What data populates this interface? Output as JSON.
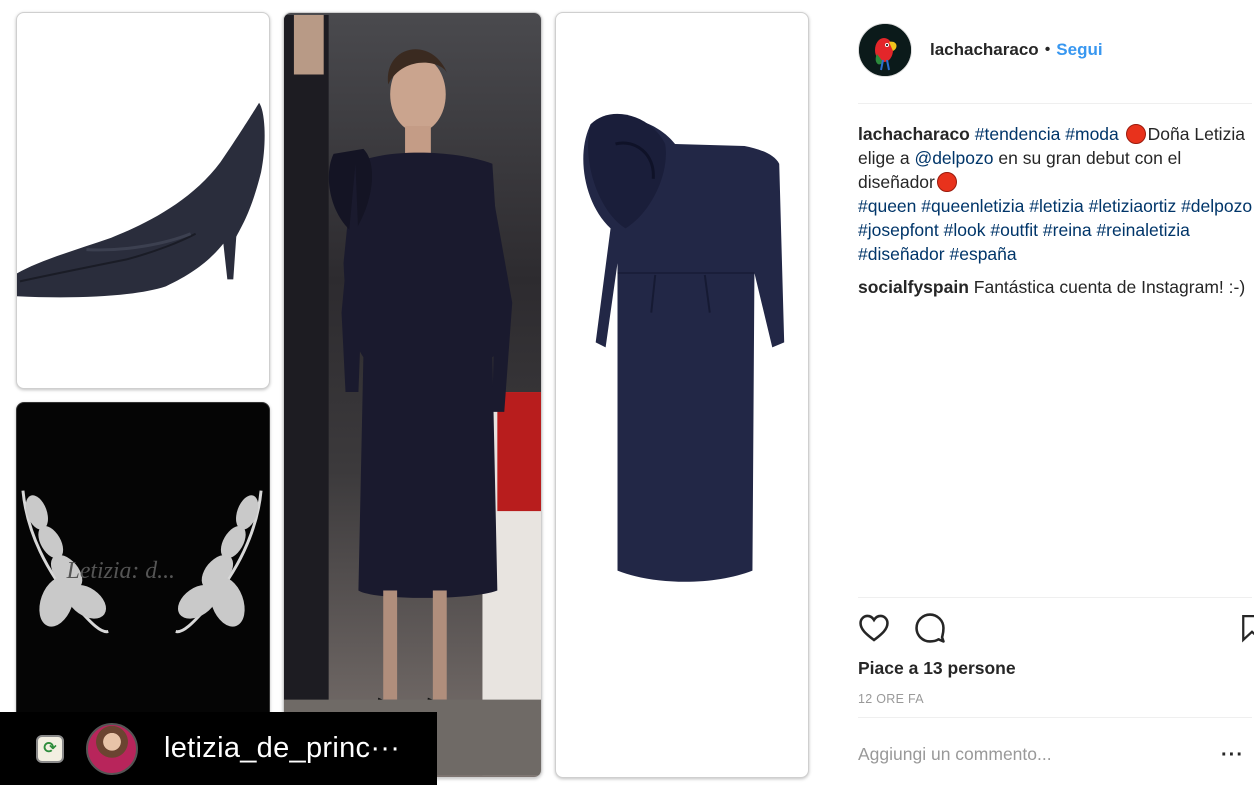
{
  "post": {
    "username": "lachacharaco",
    "follow_label": "Segui",
    "separator": "•"
  },
  "collage": {
    "repost_username": "letizia_de_princ···",
    "watermark": "Letizia: d..."
  },
  "caption": {
    "username": "lachacharaco",
    "segments": [
      {
        "type": "tag",
        "text": "#tendencia"
      },
      {
        "type": "text",
        "text": " "
      },
      {
        "type": "tag",
        "text": "#moda"
      },
      {
        "type": "text",
        "text": " "
      },
      {
        "type": "emoji",
        "text": "red-circle"
      },
      {
        "type": "text",
        "text": "Doña Letizia elige a "
      },
      {
        "type": "tag",
        "text": "@delpozo"
      },
      {
        "type": "text",
        "text": " en su gran debut con el diseñador"
      },
      {
        "type": "emoji",
        "text": "red-circle"
      },
      {
        "type": "br",
        "text": ""
      },
      {
        "type": "tag",
        "text": "#queen"
      },
      {
        "type": "text",
        "text": " "
      },
      {
        "type": "tag",
        "text": "#queenletizia"
      },
      {
        "type": "text",
        "text": " "
      },
      {
        "type": "tag",
        "text": "#letizia"
      },
      {
        "type": "text",
        "text": " "
      },
      {
        "type": "tag",
        "text": "#letiziaortiz"
      },
      {
        "type": "text",
        "text": " "
      },
      {
        "type": "tag",
        "text": "#delpozo"
      },
      {
        "type": "text",
        "text": " "
      },
      {
        "type": "tag",
        "text": "#josepfont"
      },
      {
        "type": "text",
        "text": " "
      },
      {
        "type": "tag",
        "text": "#look"
      },
      {
        "type": "text",
        "text": " "
      },
      {
        "type": "tag",
        "text": "#outfit"
      },
      {
        "type": "text",
        "text": " "
      },
      {
        "type": "tag",
        "text": "#reina"
      },
      {
        "type": "text",
        "text": " "
      },
      {
        "type": "tag",
        "text": "#reinaletizia"
      },
      {
        "type": "text",
        "text": " "
      },
      {
        "type": "tag",
        "text": "#diseñador"
      },
      {
        "type": "text",
        "text": " "
      },
      {
        "type": "tag",
        "text": "#españa"
      }
    ]
  },
  "comments": [
    {
      "username": "socialfyspain",
      "text": "Fantástica cuenta de Instagram! :-)"
    }
  ],
  "stats": {
    "likes_label": "Piace a 13 persone",
    "time_label": "12 ORE FA"
  },
  "add_comment": {
    "placeholder": "Aggiungi un commento...",
    "more_label": "···"
  },
  "icons": {
    "like": "heart-outline-icon",
    "comment": "speech-bubble-icon",
    "save": "bookmark-outline-icon",
    "repost": "repost-icon"
  },
  "colors": {
    "link": "#003569",
    "follow": "#3897f0",
    "muted": "#999999",
    "emoji_red": "#e8321c"
  }
}
